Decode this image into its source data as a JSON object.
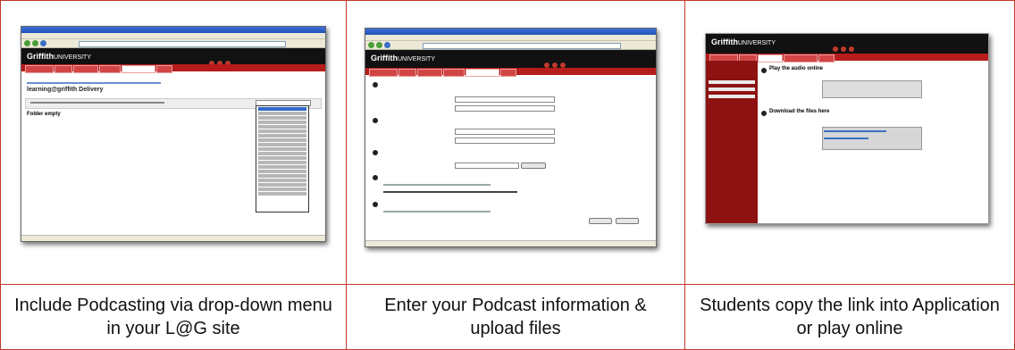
{
  "captions": [
    "Include Podcasting via drop-down menu in your L@G site",
    "Enter your Podcast information & upload files",
    "Students copy the link into Application or play online"
  ],
  "colors": {
    "grid_border": "#c0392b",
    "griffith_red": "#b71c1c",
    "banner": "#111111"
  },
  "screenshots": [
    {
      "logo": "Griffith",
      "logo_suffix": "UNIVERSITY",
      "page_title": "learning@griffith Delivery",
      "folder_text": "Folder empty"
    },
    {
      "logo": "Griffith",
      "logo_suffix": "UNIVERSITY"
    },
    {
      "logo": "Griffith",
      "logo_suffix": "UNIVERSITY",
      "step1": "Play the audio online",
      "step2": "Download the files here"
    }
  ]
}
